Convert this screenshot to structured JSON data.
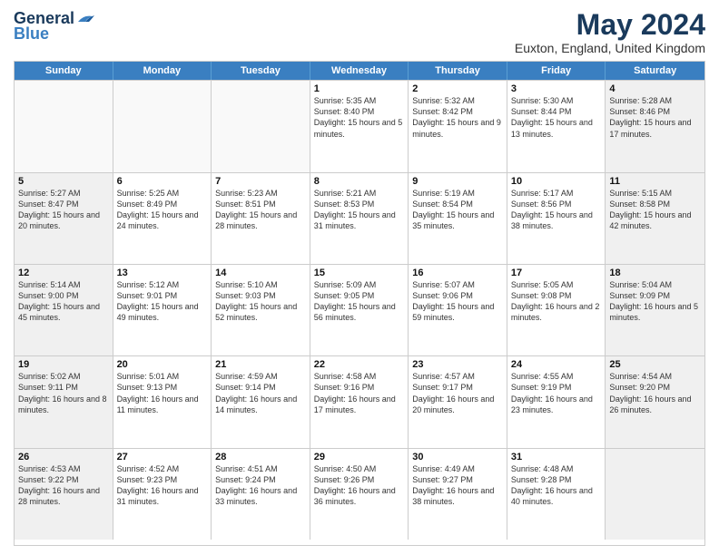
{
  "logo": {
    "line1": "General",
    "line2": "Blue"
  },
  "title": "May 2024",
  "subtitle": "Euxton, England, United Kingdom",
  "weekdays": [
    "Sunday",
    "Monday",
    "Tuesday",
    "Wednesday",
    "Thursday",
    "Friday",
    "Saturday"
  ],
  "weeks": [
    [
      {
        "day": "",
        "text": "",
        "empty": true
      },
      {
        "day": "",
        "text": "",
        "empty": true
      },
      {
        "day": "",
        "text": "",
        "empty": true
      },
      {
        "day": "1",
        "text": "Sunrise: 5:35 AM\nSunset: 8:40 PM\nDaylight: 15 hours\nand 5 minutes."
      },
      {
        "day": "2",
        "text": "Sunrise: 5:32 AM\nSunset: 8:42 PM\nDaylight: 15 hours\nand 9 minutes."
      },
      {
        "day": "3",
        "text": "Sunrise: 5:30 AM\nSunset: 8:44 PM\nDaylight: 15 hours\nand 13 minutes."
      },
      {
        "day": "4",
        "text": "Sunrise: 5:28 AM\nSunset: 8:46 PM\nDaylight: 15 hours\nand 17 minutes.",
        "shaded": true
      }
    ],
    [
      {
        "day": "5",
        "text": "Sunrise: 5:27 AM\nSunset: 8:47 PM\nDaylight: 15 hours\nand 20 minutes.",
        "shaded": true
      },
      {
        "day": "6",
        "text": "Sunrise: 5:25 AM\nSunset: 8:49 PM\nDaylight: 15 hours\nand 24 minutes."
      },
      {
        "day": "7",
        "text": "Sunrise: 5:23 AM\nSunset: 8:51 PM\nDaylight: 15 hours\nand 28 minutes."
      },
      {
        "day": "8",
        "text": "Sunrise: 5:21 AM\nSunset: 8:53 PM\nDaylight: 15 hours\nand 31 minutes."
      },
      {
        "day": "9",
        "text": "Sunrise: 5:19 AM\nSunset: 8:54 PM\nDaylight: 15 hours\nand 35 minutes."
      },
      {
        "day": "10",
        "text": "Sunrise: 5:17 AM\nSunset: 8:56 PM\nDaylight: 15 hours\nand 38 minutes."
      },
      {
        "day": "11",
        "text": "Sunrise: 5:15 AM\nSunset: 8:58 PM\nDaylight: 15 hours\nand 42 minutes.",
        "shaded": true
      }
    ],
    [
      {
        "day": "12",
        "text": "Sunrise: 5:14 AM\nSunset: 9:00 PM\nDaylight: 15 hours\nand 45 minutes.",
        "shaded": true
      },
      {
        "day": "13",
        "text": "Sunrise: 5:12 AM\nSunset: 9:01 PM\nDaylight: 15 hours\nand 49 minutes."
      },
      {
        "day": "14",
        "text": "Sunrise: 5:10 AM\nSunset: 9:03 PM\nDaylight: 15 hours\nand 52 minutes."
      },
      {
        "day": "15",
        "text": "Sunrise: 5:09 AM\nSunset: 9:05 PM\nDaylight: 15 hours\nand 56 minutes."
      },
      {
        "day": "16",
        "text": "Sunrise: 5:07 AM\nSunset: 9:06 PM\nDaylight: 15 hours\nand 59 minutes."
      },
      {
        "day": "17",
        "text": "Sunrise: 5:05 AM\nSunset: 9:08 PM\nDaylight: 16 hours\nand 2 minutes."
      },
      {
        "day": "18",
        "text": "Sunrise: 5:04 AM\nSunset: 9:09 PM\nDaylight: 16 hours\nand 5 minutes.",
        "shaded": true
      }
    ],
    [
      {
        "day": "19",
        "text": "Sunrise: 5:02 AM\nSunset: 9:11 PM\nDaylight: 16 hours\nand 8 minutes.",
        "shaded": true
      },
      {
        "day": "20",
        "text": "Sunrise: 5:01 AM\nSunset: 9:13 PM\nDaylight: 16 hours\nand 11 minutes."
      },
      {
        "day": "21",
        "text": "Sunrise: 4:59 AM\nSunset: 9:14 PM\nDaylight: 16 hours\nand 14 minutes."
      },
      {
        "day": "22",
        "text": "Sunrise: 4:58 AM\nSunset: 9:16 PM\nDaylight: 16 hours\nand 17 minutes."
      },
      {
        "day": "23",
        "text": "Sunrise: 4:57 AM\nSunset: 9:17 PM\nDaylight: 16 hours\nand 20 minutes."
      },
      {
        "day": "24",
        "text": "Sunrise: 4:55 AM\nSunset: 9:19 PM\nDaylight: 16 hours\nand 23 minutes."
      },
      {
        "day": "25",
        "text": "Sunrise: 4:54 AM\nSunset: 9:20 PM\nDaylight: 16 hours\nand 26 minutes.",
        "shaded": true
      }
    ],
    [
      {
        "day": "26",
        "text": "Sunrise: 4:53 AM\nSunset: 9:22 PM\nDaylight: 16 hours\nand 28 minutes.",
        "shaded": true
      },
      {
        "day": "27",
        "text": "Sunrise: 4:52 AM\nSunset: 9:23 PM\nDaylight: 16 hours\nand 31 minutes."
      },
      {
        "day": "28",
        "text": "Sunrise: 4:51 AM\nSunset: 9:24 PM\nDaylight: 16 hours\nand 33 minutes."
      },
      {
        "day": "29",
        "text": "Sunrise: 4:50 AM\nSunset: 9:26 PM\nDaylight: 16 hours\nand 36 minutes."
      },
      {
        "day": "30",
        "text": "Sunrise: 4:49 AM\nSunset: 9:27 PM\nDaylight: 16 hours\nand 38 minutes."
      },
      {
        "day": "31",
        "text": "Sunrise: 4:48 AM\nSunset: 9:28 PM\nDaylight: 16 hours\nand 40 minutes."
      },
      {
        "day": "",
        "text": "",
        "empty": true,
        "shaded": true
      }
    ]
  ]
}
